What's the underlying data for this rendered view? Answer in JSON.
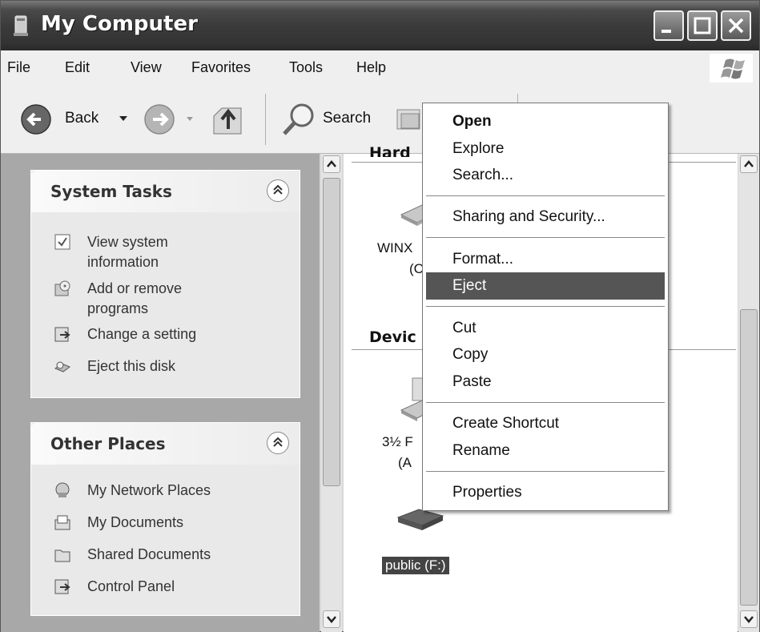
{
  "window": {
    "title": "My Computer"
  },
  "menu": [
    "File",
    "Edit",
    "View",
    "Favorites",
    "Tools",
    "Help"
  ],
  "toolbar": {
    "back_label": "Back",
    "search_label": "Search"
  },
  "system_tasks": {
    "title": "System Tasks",
    "items": [
      {
        "label_line1": "View system",
        "label_line2": "information",
        "icon": "info-window-icon"
      },
      {
        "label_line1": "Add or remove",
        "label_line2": "programs",
        "icon": "cd-box-icon"
      },
      {
        "label_line1": "Change a setting",
        "label_line2": "",
        "icon": "control-panel-icon"
      },
      {
        "label_line1": "Eject this disk",
        "label_line2": "",
        "icon": "eject-drive-icon"
      }
    ]
  },
  "other_places": {
    "title": "Other Places",
    "items": [
      {
        "label": "My Network Places",
        "icon": "network-places-icon"
      },
      {
        "label": "My Documents",
        "icon": "my-documents-icon"
      },
      {
        "label": "Shared Documents",
        "icon": "shared-folder-icon"
      },
      {
        "label": "Control Panel",
        "icon": "control-panel-icon"
      }
    ]
  },
  "main": {
    "hard_disk_header": "Hard Disk Drives",
    "devices_header": "Devices with Removable Storage",
    "drive1_line1": "WINX",
    "drive1_line2": "(C",
    "floppy_line1": "3½ F",
    "floppy_line2": "(A",
    "public_drive_label": "public (F:)"
  },
  "context_menu": {
    "items": [
      "Open",
      "Explore",
      "Search...",
      "Sharing and Security...",
      "Format...",
      "Eject",
      "Cut",
      "Copy",
      "Paste",
      "Create Shortcut",
      "Rename",
      "Properties"
    ],
    "highlighted": "Eject"
  }
}
